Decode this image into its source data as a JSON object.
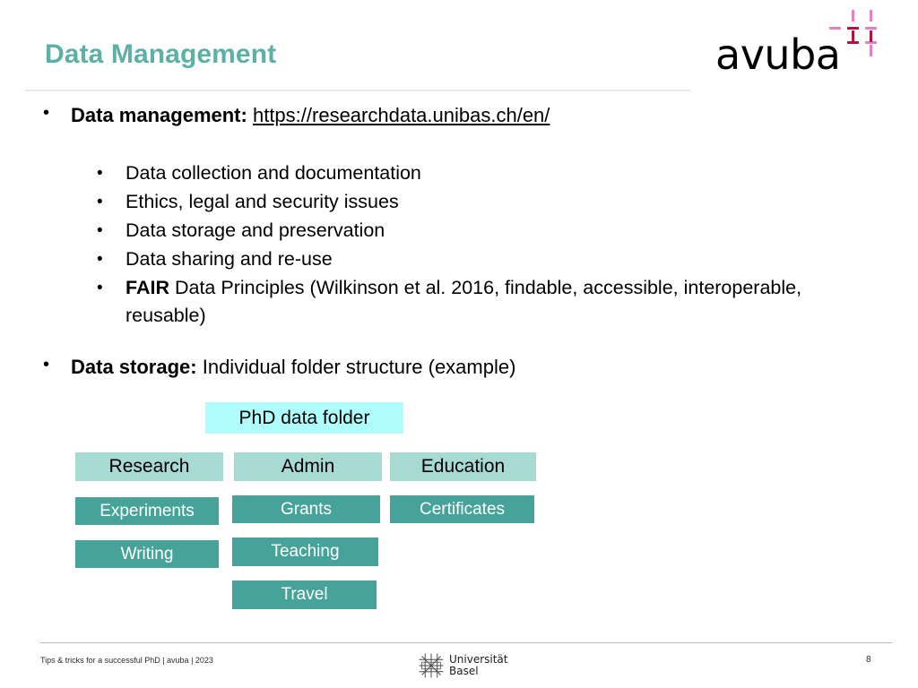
{
  "slide": {
    "title": "Data Management",
    "page_number": "8"
  },
  "logo": {
    "wordmark": "avuba",
    "grid_colors": {
      "pink": "#e87ec4",
      "crimson": "#b5123c"
    }
  },
  "theme": {
    "title_teal": "#5cb0a5",
    "root_cyan": "#affdfd",
    "level1_teal": "#a8dad4",
    "level2_teal": "#46a39a",
    "rule_grey": "#e9e9e9",
    "footer_rule_grey": "#b9b9b9"
  },
  "body": {
    "bullets": [
      {
        "label": "Data management:",
        "link": "https://researchdata.unibas.ch/en/"
      },
      {
        "label": "Data storage:",
        "rest": "Individual folder structure (example)"
      }
    ],
    "sub_bullets": [
      {
        "text": "Data collection and documentation"
      },
      {
        "text": "Ethics, legal and security issues"
      },
      {
        "text": "Data storage and preservation"
      },
      {
        "text": "Data sharing and re-use"
      },
      {
        "bold": "FAIR",
        "text": "Data Principles (Wilkinson et al. 2016, findable, accessible, interoperable, reusable)"
      }
    ],
    "bullet_glyph": "•"
  },
  "diagram": {
    "root": {
      "label": "PhD data folder"
    },
    "columns": [
      {
        "parent": "Research",
        "children": [
          "Experiments",
          "Writing"
        ]
      },
      {
        "parent": "Admin",
        "children": [
          "Grants",
          "Teaching",
          "Travel"
        ]
      },
      {
        "parent": "Education",
        "children": [
          "Certificates"
        ]
      }
    ]
  },
  "footer": {
    "text": "Tips & tricks for a successful PhD | avuba | 2023",
    "university_line1": "Universität",
    "university_line2": "Basel"
  }
}
